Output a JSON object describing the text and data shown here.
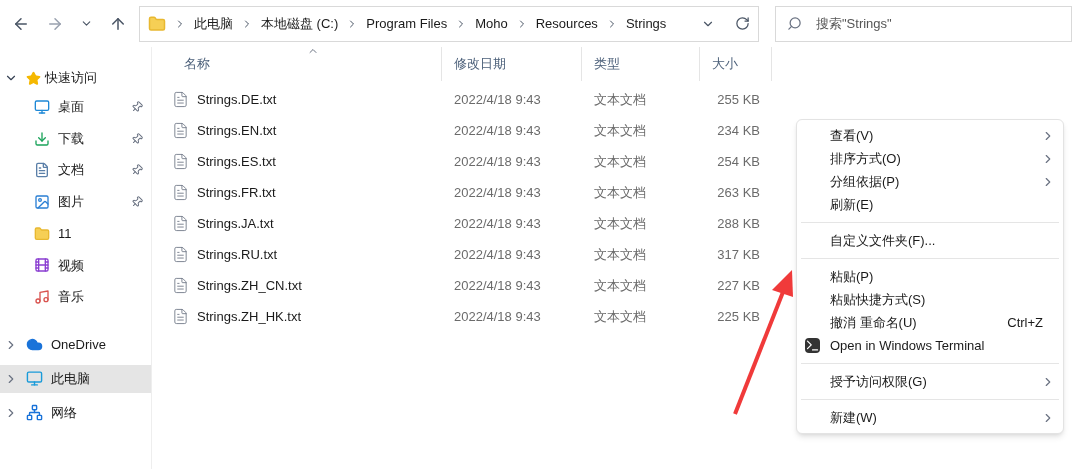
{
  "toolbar": {
    "path": [
      {
        "label": "此电脑"
      },
      {
        "label": "本地磁盘 (C:)"
      },
      {
        "label": "Program Files"
      },
      {
        "label": "Moho"
      },
      {
        "label": "Resources"
      },
      {
        "label": "Strings"
      }
    ],
    "search": {
      "placeholder": "搜索\"Strings\""
    }
  },
  "sidebar": {
    "quick_access": {
      "label": "快速访问",
      "expanded": true,
      "items": [
        {
          "label": "桌面",
          "pinned": true
        },
        {
          "label": "下载",
          "pinned": true
        },
        {
          "label": "文档",
          "pinned": true
        },
        {
          "label": "图片",
          "pinned": true
        },
        {
          "label": "11",
          "pinned": false
        },
        {
          "label": "视频",
          "pinned": false
        },
        {
          "label": "音乐",
          "pinned": false
        }
      ]
    },
    "items": [
      {
        "label": "OneDrive",
        "expanded": false,
        "selected": false
      },
      {
        "label": "此电脑",
        "expanded": false,
        "selected": true
      },
      {
        "label": "网络",
        "expanded": false,
        "selected": false
      }
    ]
  },
  "table": {
    "columns": [
      {
        "label": "名称",
        "sorted": true
      },
      {
        "label": "修改日期",
        "sorted": false
      },
      {
        "label": "类型",
        "sorted": false
      },
      {
        "label": "大小",
        "sorted": false
      }
    ],
    "rows": [
      {
        "name": "Strings.DE.txt",
        "date": "2022/4/18 9:43",
        "type": "文本文档",
        "size": "255 KB"
      },
      {
        "name": "Strings.EN.txt",
        "date": "2022/4/18 9:43",
        "type": "文本文档",
        "size": "234 KB"
      },
      {
        "name": "Strings.ES.txt",
        "date": "2022/4/18 9:43",
        "type": "文本文档",
        "size": "254 KB"
      },
      {
        "name": "Strings.FR.txt",
        "date": "2022/4/18 9:43",
        "type": "文本文档",
        "size": "263 KB"
      },
      {
        "name": "Strings.JA.txt",
        "date": "2022/4/18 9:43",
        "type": "文本文档",
        "size": "288 KB"
      },
      {
        "name": "Strings.RU.txt",
        "date": "2022/4/18 9:43",
        "type": "文本文档",
        "size": "317 KB"
      },
      {
        "name": "Strings.ZH_CN.txt",
        "date": "2022/4/18 9:43",
        "type": "文本文档",
        "size": "227 KB"
      },
      {
        "name": "Strings.ZH_HK.txt",
        "date": "2022/4/18 9:43",
        "type": "文本文档",
        "size": "225 KB"
      }
    ]
  },
  "context_menu": [
    {
      "kind": "item",
      "label": "查看(V)",
      "submenu": true
    },
    {
      "kind": "item",
      "label": "排序方式(O)",
      "submenu": true
    },
    {
      "kind": "item",
      "label": "分组依据(P)",
      "submenu": true
    },
    {
      "kind": "item",
      "label": "刷新(E)",
      "submenu": false
    },
    {
      "kind": "separator"
    },
    {
      "kind": "item",
      "label": "自定义文件夹(F)...",
      "submenu": false
    },
    {
      "kind": "separator"
    },
    {
      "kind": "item",
      "label": "粘贴(P)",
      "submenu": false
    },
    {
      "kind": "item",
      "label": "粘贴快捷方式(S)",
      "submenu": false
    },
    {
      "kind": "item",
      "label": "撤消 重命名(U)",
      "submenu": false,
      "shortcut": "Ctrl+Z"
    },
    {
      "kind": "terminal",
      "label": "Open in Windows Terminal",
      "submenu": false
    },
    {
      "kind": "separator"
    },
    {
      "kind": "item",
      "label": "授予访问权限(G)",
      "submenu": true
    },
    {
      "kind": "separator"
    },
    {
      "kind": "item",
      "label": "新建(W)",
      "submenu": true
    }
  ],
  "annotation": {
    "kind": "arrow"
  }
}
